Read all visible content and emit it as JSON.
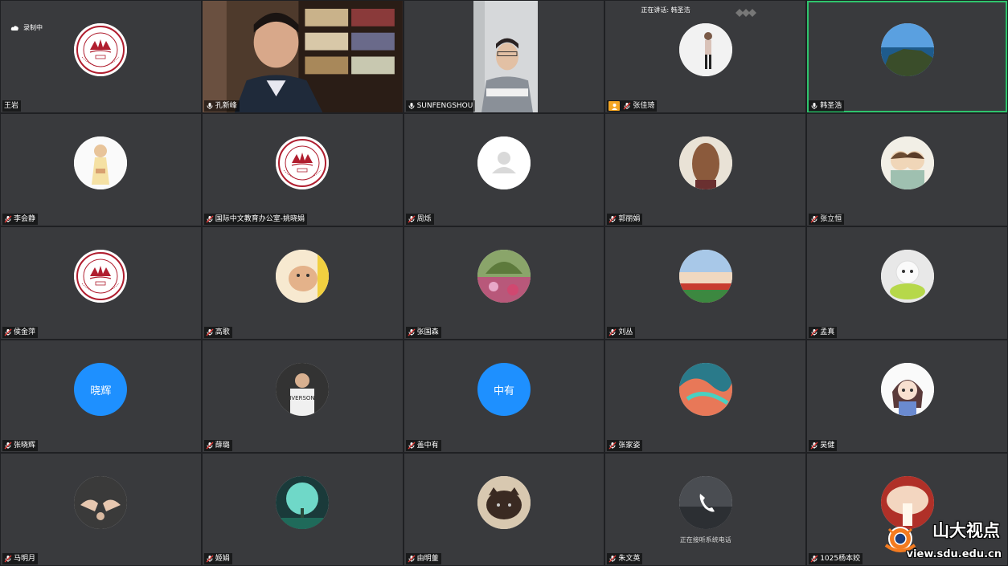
{
  "meeting": {
    "recording_label": "录制中",
    "speaking_label": "正在讲话: 韩圣浩",
    "call_status": "正在接听系统电话"
  },
  "watermark": {
    "title": "山大视点",
    "url": "view.sdu.edu.cn"
  },
  "colors": {
    "tile_bg": "#393a3d",
    "active_border": "#2fc46d",
    "text_avatar_bg": "#1e90ff"
  },
  "participants": [
    {
      "name": "王岩",
      "avatar": "sdu-logo",
      "mic": "none"
    },
    {
      "name": "孔新峰",
      "avatar": "video-bookshelf",
      "mic": "on"
    },
    {
      "name": "SUNFENGSHOU",
      "avatar": "video-man-office",
      "mic": "on"
    },
    {
      "name": "张佳琦",
      "avatar": "photo-person-standing",
      "mic": "muted",
      "host": true
    },
    {
      "name": "韩圣浩",
      "avatar": "photo-coast",
      "mic": "on",
      "active": true
    },
    {
      "name": "李会静",
      "avatar": "photo-illustration-girl",
      "mic": "muted"
    },
    {
      "name": "国际中文教育办公室-姚晓娟",
      "avatar": "sdu-logo",
      "mic": "muted"
    },
    {
      "name": "周烁",
      "avatar": "default-user-icon",
      "mic": "muted"
    },
    {
      "name": "郭丽娟",
      "avatar": "photo-long-hair",
      "mic": "muted"
    },
    {
      "name": "张立恒",
      "avatar": "photo-cartoon-couple",
      "mic": "muted"
    },
    {
      "name": "侯金萍",
      "avatar": "sdu-logo",
      "mic": "muted"
    },
    {
      "name": "高歌",
      "avatar": "photo-puppy",
      "mic": "muted"
    },
    {
      "name": "张国森",
      "avatar": "photo-garden",
      "mic": "muted"
    },
    {
      "name": "刘丛",
      "avatar": "photo-flower-field",
      "mic": "muted"
    },
    {
      "name": "孟真",
      "avatar": "photo-white-dog",
      "mic": "muted"
    },
    {
      "name": "张晓辉",
      "avatar": "text",
      "avatar_text": "晓辉",
      "mic": "muted"
    },
    {
      "name": "薛璐",
      "avatar": "photo-basketball",
      "mic": "muted"
    },
    {
      "name": "盖中有",
      "avatar": "text",
      "avatar_text": "中有",
      "mic": "muted"
    },
    {
      "name": "张家姿",
      "avatar": "photo-painting",
      "mic": "muted"
    },
    {
      "name": "吴健",
      "avatar": "photo-anime-girl",
      "mic": "muted"
    },
    {
      "name": "马明月",
      "avatar": "photo-hands",
      "mic": "muted"
    },
    {
      "name": "姬娟",
      "avatar": "photo-tree",
      "mic": "muted"
    },
    {
      "name": "由明董",
      "avatar": "photo-cat",
      "mic": "muted"
    },
    {
      "name": "朱文英",
      "avatar": "phone-icon",
      "mic": "muted",
      "on_call": true
    },
    {
      "name": "1025杨本姣",
      "avatar": "photo-mushroom",
      "mic": "muted"
    }
  ]
}
